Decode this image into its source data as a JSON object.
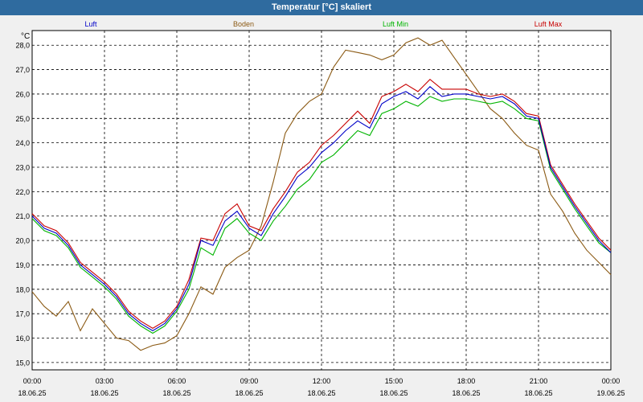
{
  "window": {
    "title": "Temperatur [°C] skaliert"
  },
  "chart_data": {
    "type": "line",
    "title": "Temperatur [°C] skaliert",
    "ylabel": "°C",
    "xlabel": "",
    "ylim": [
      14.7,
      28.6
    ],
    "xlim": [
      0,
      24
    ],
    "grid": true,
    "y_ticks": [
      "15,0",
      "16,0",
      "17,0",
      "18,0",
      "19,0",
      "20,0",
      "21,0",
      "22,0",
      "23,0",
      "24,0",
      "25,0",
      "26,0",
      "27,0",
      "28,0"
    ],
    "x_ticks": [
      {
        "x": 0,
        "time": "00:00",
        "date": "18.06.25"
      },
      {
        "x": 3,
        "time": "03:00",
        "date": "18.06.25"
      },
      {
        "x": 6,
        "time": "06:00",
        "date": "18.06.25"
      },
      {
        "x": 9,
        "time": "09:00",
        "date": "18.06.25"
      },
      {
        "x": 12,
        "time": "12:00",
        "date": "18.06.25"
      },
      {
        "x": 15,
        "time": "15:00",
        "date": "18.06.25"
      },
      {
        "x": 18,
        "time": "18:00",
        "date": "18.06.25"
      },
      {
        "x": 21,
        "time": "21:00",
        "date": "18.06.25"
      },
      {
        "x": 24,
        "time": "00:00",
        "date": "19.06.25"
      }
    ],
    "x": [
      0,
      0.5,
      1,
      1.5,
      2,
      2.5,
      3,
      3.5,
      4,
      4.5,
      5,
      5.5,
      6,
      6.5,
      7,
      7.5,
      8,
      8.5,
      9,
      9.5,
      10,
      10.5,
      11,
      11.5,
      12,
      12.5,
      13,
      13.5,
      14,
      14.5,
      15,
      15.5,
      16,
      16.5,
      17,
      17.5,
      18,
      18.5,
      19,
      19.5,
      20,
      20.5,
      21,
      21.5,
      22,
      22.5,
      23,
      23.5,
      24
    ],
    "series": [
      {
        "name": "Luft",
        "color": "#0000c8",
        "values": [
          21.0,
          20.5,
          20.3,
          19.8,
          19.0,
          18.6,
          18.2,
          17.7,
          17.0,
          16.6,
          16.3,
          16.6,
          17.2,
          18.2,
          20.0,
          19.8,
          20.8,
          21.2,
          20.5,
          20.2,
          21.1,
          21.8,
          22.6,
          23.0,
          23.6,
          24.0,
          24.5,
          24.9,
          24.6,
          25.6,
          25.9,
          26.1,
          25.8,
          26.3,
          25.9,
          26.0,
          26.0,
          25.9,
          25.8,
          25.9,
          25.6,
          25.1,
          25.0,
          23.0,
          22.2,
          21.4,
          20.7,
          20.0,
          19.5
        ]
      },
      {
        "name": "Boden",
        "color": "#8b5a14",
        "values": [
          17.9,
          17.3,
          16.9,
          17.5,
          16.3,
          17.2,
          16.6,
          16.0,
          15.9,
          15.5,
          15.7,
          15.8,
          16.1,
          17.0,
          18.1,
          17.8,
          18.9,
          19.3,
          19.6,
          20.6,
          22.4,
          24.4,
          25.2,
          25.7,
          26.0,
          27.1,
          27.8,
          27.7,
          27.6,
          27.4,
          27.6,
          28.1,
          28.3,
          28.0,
          28.2,
          27.5,
          26.8,
          26.1,
          25.4,
          25.0,
          24.4,
          23.9,
          23.7,
          21.9,
          21.2,
          20.3,
          19.6,
          19.1,
          18.6
        ]
      },
      {
        "name": "Luft Min",
        "color": "#00b400",
        "values": [
          20.9,
          20.4,
          20.2,
          19.7,
          18.9,
          18.5,
          18.1,
          17.6,
          16.9,
          16.5,
          16.2,
          16.5,
          17.1,
          18.0,
          19.7,
          19.4,
          20.5,
          20.9,
          20.3,
          20.0,
          20.8,
          21.4,
          22.1,
          22.5,
          23.2,
          23.5,
          24.0,
          24.5,
          24.3,
          25.2,
          25.4,
          25.7,
          25.5,
          25.9,
          25.7,
          25.8,
          25.8,
          25.7,
          25.6,
          25.7,
          25.4,
          25.0,
          24.9,
          22.9,
          22.1,
          21.3,
          20.6,
          19.9,
          19.5
        ]
      },
      {
        "name": "Luft Max",
        "color": "#c80000",
        "values": [
          21.1,
          20.6,
          20.4,
          19.9,
          19.1,
          18.7,
          18.3,
          17.8,
          17.1,
          16.7,
          16.4,
          16.7,
          17.3,
          18.4,
          20.1,
          20.0,
          21.1,
          21.5,
          20.6,
          20.4,
          21.3,
          22.0,
          22.8,
          23.2,
          23.9,
          24.3,
          24.8,
          25.3,
          24.8,
          25.9,
          26.1,
          26.4,
          26.1,
          26.6,
          26.2,
          26.2,
          26.2,
          26.0,
          25.9,
          26.0,
          25.7,
          25.2,
          25.1,
          23.1,
          22.3,
          21.5,
          20.8,
          20.1,
          19.6
        ]
      }
    ]
  }
}
